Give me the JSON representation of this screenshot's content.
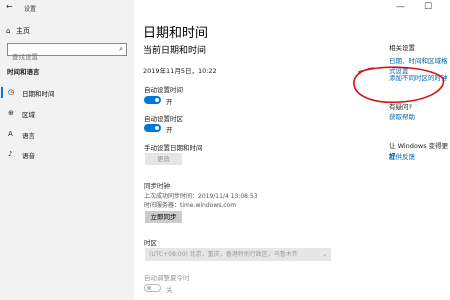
{
  "window": {
    "title": "设置",
    "back_glyph": "←",
    "minimize": "—",
    "maximize": "☐"
  },
  "sidebar": {
    "home": "主页",
    "search": {
      "placeholder": "查找设置"
    },
    "section_title": "时间和语言",
    "items": [
      {
        "label": "日期和时间",
        "icon": "clock-icon",
        "active": true
      },
      {
        "label": "区域",
        "icon": "globe-icon",
        "active": false
      },
      {
        "label": "语言",
        "icon": "language-icon",
        "active": false
      },
      {
        "label": "语音",
        "icon": "microphone-icon",
        "active": false
      }
    ]
  },
  "main": {
    "title": "日期和时间",
    "subtitle": "当前日期和时间",
    "current_datetime": "2019年11月5日，10:22",
    "auto_time": {
      "label": "自动设置时间",
      "state": "开",
      "on": true
    },
    "auto_timezone": {
      "label": "自动设置时区",
      "state": "开",
      "on": true
    },
    "manual": {
      "label": "手动设置日期和时间",
      "button": "更改"
    },
    "sync": {
      "title": "同步时钟",
      "last_sync": "上次成功同步时间：2019/11/4 13:08:53",
      "server": "时间服务器：time.windows.com",
      "button": "立即同步"
    },
    "timezone": {
      "label": "时区",
      "value": "(UTC+08:00) 北京，重庆，香港特别行政区，乌鲁木齐"
    },
    "dst": {
      "label": "自动调整夏令时",
      "state": "关",
      "on": false
    }
  },
  "related": {
    "title": "相关设置",
    "link1": "日期、时间和区域格式设置",
    "link2": "添加不同时区的时钟",
    "help_title": "有疑问?",
    "help_link": "获取帮助",
    "improve_text": "让 Windows 变得更好",
    "feedback_link": "提供反馈"
  },
  "colors": {
    "accent": "#0078d7",
    "link": "#0066b4",
    "annotation": "#d11414",
    "sidebar_bg": "#f2f2f2"
  }
}
